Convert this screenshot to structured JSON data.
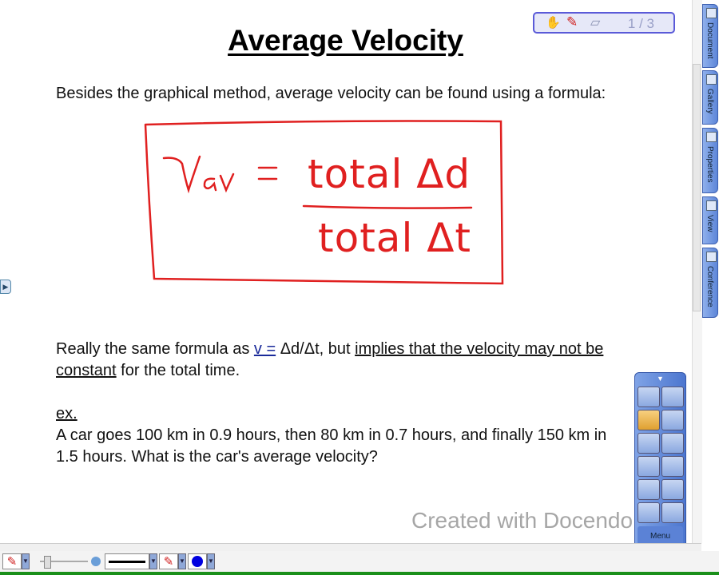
{
  "slide": {
    "title": "Average Velocity",
    "intro": "Besides the graphical method, average velocity can be found using a formula:",
    "formula": {
      "lhs": "v_av",
      "numerator": "total Δd",
      "denominator": "total Δt",
      "ink_color": "#e02020"
    },
    "line2_a": "Really the same formula as ",
    "line2_v": "v =",
    "line2_b": " Δd/Δt, but ",
    "line2_ul": "implies that the velocity may not be constant",
    "line2_c": " for the total time.",
    "ex_label": "ex.",
    "example": "A car goes 100 km in 0.9 hours, then 80 km in 0.7 hours, and finally 150 km in 1.5 hours.  What is the car's average velocity?"
  },
  "page_indicator": "1 / 3",
  "side_tabs": [
    "Document",
    "Gallery",
    "Properties",
    "View",
    "Conference"
  ],
  "watermark": "Created with Docendo",
  "floating_toolbar": {
    "label": "Menu"
  },
  "colors": {
    "pen_color": "#0000e0",
    "accent": "#4c76cf"
  }
}
